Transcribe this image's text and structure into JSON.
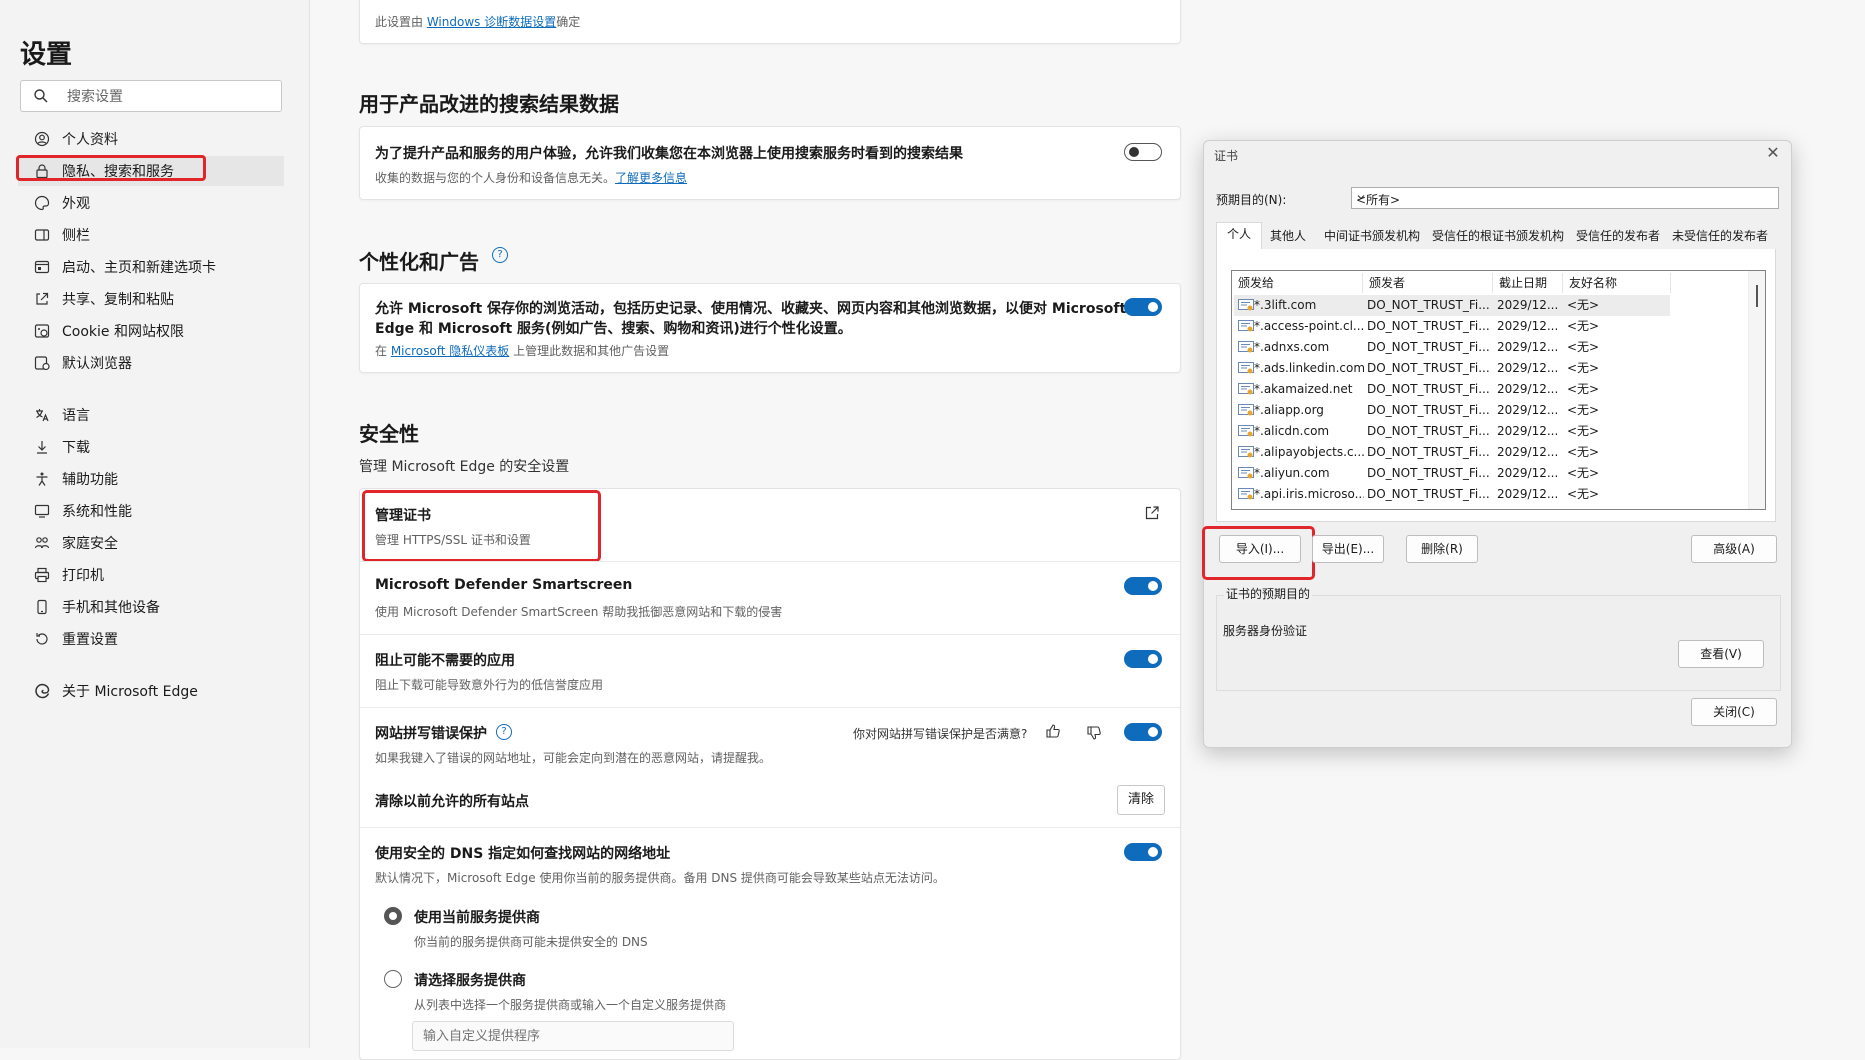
{
  "sidebar": {
    "title": "设置",
    "search_placeholder": "搜索设置",
    "items": [
      {
        "label": "个人资料",
        "icon": "profile-icon"
      },
      {
        "label": "隐私、搜索和服务",
        "icon": "lock-icon"
      },
      {
        "label": "外观",
        "icon": "appearance-icon"
      },
      {
        "label": "侧栏",
        "icon": "sidebar-icon"
      },
      {
        "label": "启动、主页和新建选项卡",
        "icon": "start-page-icon"
      },
      {
        "label": "共享、复制和粘贴",
        "icon": "share-icon"
      },
      {
        "label": "Cookie 和网站权限",
        "icon": "cookie-icon"
      },
      {
        "label": "默认浏览器",
        "icon": "browser-icon"
      },
      {
        "label": "语言",
        "icon": "language-icon"
      },
      {
        "label": "下载",
        "icon": "download-icon"
      },
      {
        "label": "辅助功能",
        "icon": "accessibility-icon"
      },
      {
        "label": "系统和性能",
        "icon": "system-icon"
      },
      {
        "label": "家庭安全",
        "icon": "family-icon"
      },
      {
        "label": "打印机",
        "icon": "printer-icon"
      },
      {
        "label": "手机和其他设备",
        "icon": "phone-icon"
      },
      {
        "label": "重置设置",
        "icon": "reset-icon"
      },
      {
        "label": "关于 Microsoft Edge",
        "icon": "edge-icon"
      }
    ]
  },
  "main": {
    "top_card": {
      "prefix": "此设置由 ",
      "link": "Windows 诊断数据设置",
      "suffix": "确定"
    },
    "search_data": {
      "heading": "用于产品改进的搜索结果数据",
      "title": "为了提升产品和服务的用户体验，允许我们收集您在本浏览器上使用搜索服务时看到的搜索结果",
      "desc": "收集的数据与您的个人身份和设备信息无关。",
      "link": "了解更多信息",
      "toggle": false
    },
    "personalization": {
      "heading": "个性化和广告",
      "title_line1": "允许 Microsoft 保存你的浏览活动，包括历史记录、使用情况、收藏夹、网页内容和其他浏览数据，以便对 Microsoft",
      "title_line2": "Edge 和 Microsoft 服务(例如广告、搜索、购物和资讯)进行个性化设置。",
      "desc_prefix": "在 ",
      "desc_link": "Microsoft 隐私仪表板",
      "desc_suffix": " 上管理此数据和其他广告设置",
      "toggle": true
    },
    "security": {
      "heading": "安全性",
      "subheading": "管理 Microsoft Edge 的安全设置",
      "manage_cert": {
        "title": "管理证书",
        "desc": "管理 HTTPS/SSL 证书和设置"
      },
      "smartscreen": {
        "title": "Microsoft Defender Smartscreen",
        "desc": "使用 Microsoft Defender SmartScreen 帮助我抵御恶意网站和下载的侵害",
        "toggle": true
      },
      "pua": {
        "title": "阻止可能不需要的应用",
        "desc": "阻止下载可能导致意外行为的低信誉度应用",
        "toggle": true
      },
      "typo": {
        "title": "网站拼写错误保护",
        "desc": "如果我键入了错误的网站地址，可能会定向到潜在的恶意网站，请提醒我。",
        "feedback": "你对网站拼写错误保护是否满意?",
        "toggle": true
      },
      "clear": {
        "title": "清除以前允许的所有站点",
        "button": "清除"
      },
      "dns": {
        "title": "使用安全的 DNS 指定如何查找网站的网络地址",
        "desc": "默认情况下，Microsoft Edge 使用你当前的服务提供商。备用 DNS 提供商可能会导致某些站点无法访问。",
        "toggle": true,
        "option1_title": "使用当前服务提供商",
        "option1_desc": "你当前的服务提供商可能未提供安全的 DNS",
        "option2_title": "请选择服务提供商",
        "option2_desc": "从列表中选择一个服务提供商或输入一个自定义服务提供商",
        "input_placeholder": "输入自定义提供程序"
      }
    }
  },
  "dialog": {
    "title": "证书",
    "purpose_label": "预期目的(N):",
    "purpose_value": "<所有>",
    "tabs": [
      "个人",
      "其他人",
      "中间证书颁发机构",
      "受信任的根证书颁发机构",
      "受信任的发布者",
      "未受信任的发布者"
    ],
    "columns": [
      "颁发给",
      "颁发者",
      "截止日期",
      "友好名称"
    ],
    "rows": [
      {
        "to": "*.3lift.com",
        "by": "DO_NOT_TRUST_Fi...",
        "exp": "2029/12...",
        "name": "<无>"
      },
      {
        "to": "*.access-point.cl...",
        "by": "DO_NOT_TRUST_Fi...",
        "exp": "2029/12...",
        "name": "<无>"
      },
      {
        "to": "*.adnxs.com",
        "by": "DO_NOT_TRUST_Fi...",
        "exp": "2029/12...",
        "name": "<无>"
      },
      {
        "to": "*.ads.linkedin.com",
        "by": "DO_NOT_TRUST_Fi...",
        "exp": "2029/12...",
        "name": "<无>"
      },
      {
        "to": "*.akamaized.net",
        "by": "DO_NOT_TRUST_Fi...",
        "exp": "2029/12...",
        "name": "<无>"
      },
      {
        "to": "*.aliapp.org",
        "by": "DO_NOT_TRUST_Fi...",
        "exp": "2029/12...",
        "name": "<无>"
      },
      {
        "to": "*.alicdn.com",
        "by": "DO_NOT_TRUST_Fi...",
        "exp": "2029/12...",
        "name": "<无>"
      },
      {
        "to": "*.alipayobjects.c...",
        "by": "DO_NOT_TRUST_Fi...",
        "exp": "2029/12...",
        "name": "<无>"
      },
      {
        "to": "*.aliyun.com",
        "by": "DO_NOT_TRUST_Fi...",
        "exp": "2029/12...",
        "name": "<无>"
      },
      {
        "to": "*.api.iris.microso...",
        "by": "DO_NOT_TRUST_Fi...",
        "exp": "2029/12...",
        "name": "<无>"
      }
    ],
    "buttons": {
      "import": "导入(I)...",
      "export": "导出(E)...",
      "remove": "删除(R)",
      "advanced": "高级(A)",
      "view": "查看(V)",
      "close": "关闭(C)"
    },
    "purpose_group_label": "证书的预期目的",
    "purpose_group_value": "服务器身份验证"
  }
}
